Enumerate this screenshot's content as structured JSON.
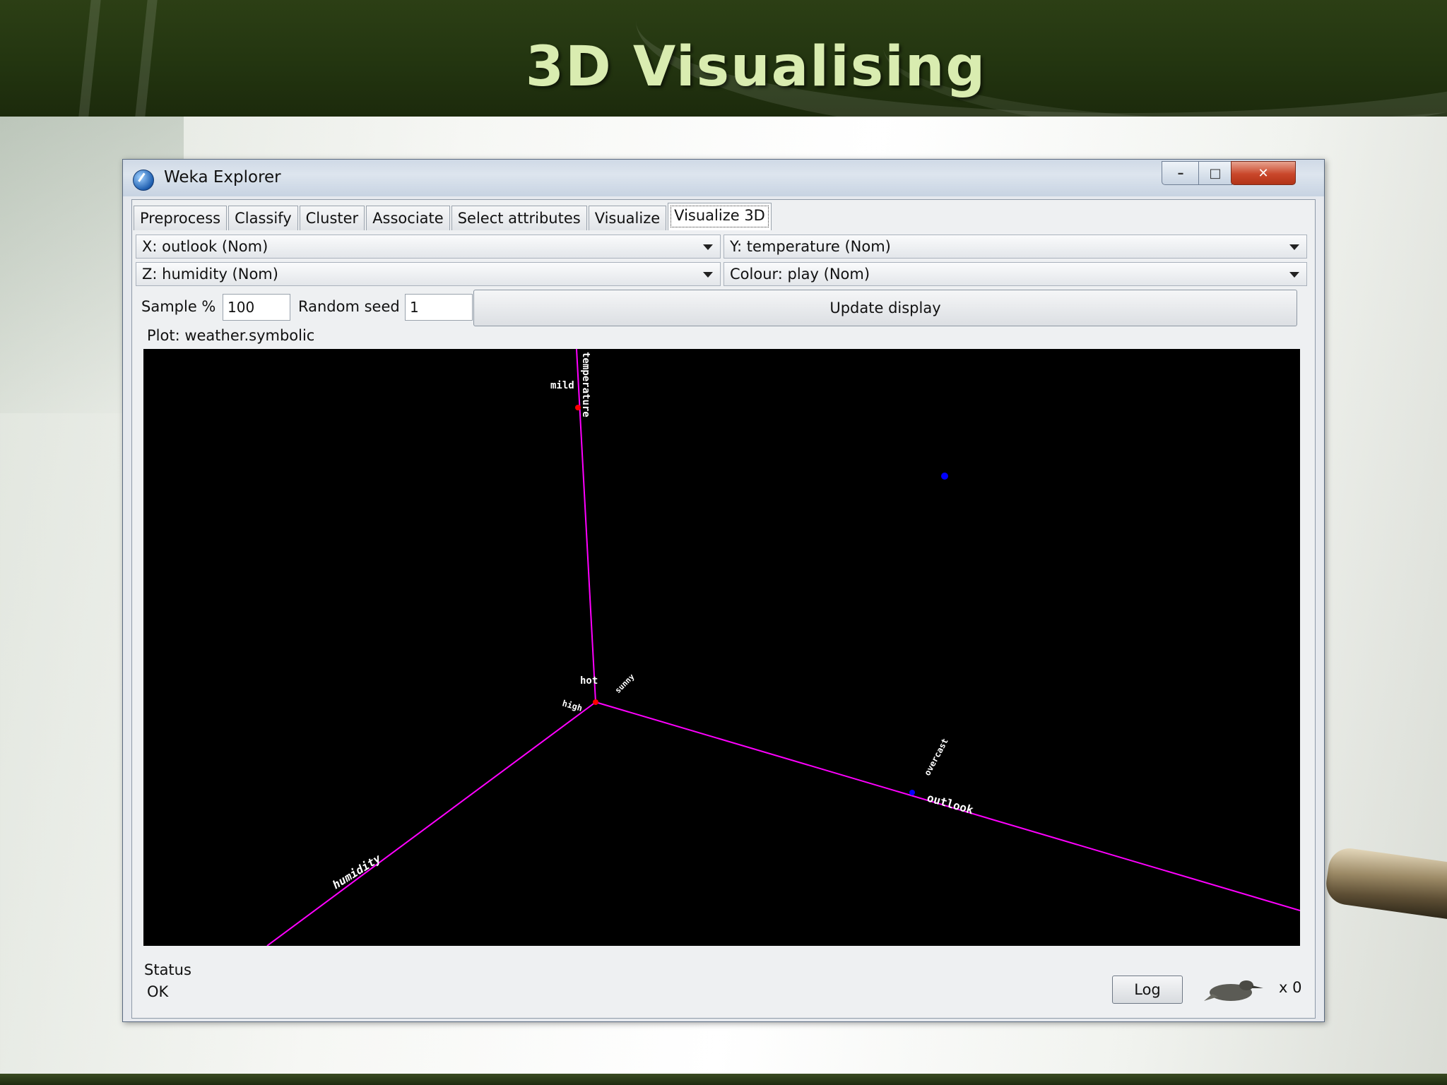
{
  "slide": {
    "title": "3D Visualising"
  },
  "window": {
    "title": "Weka Explorer",
    "controls": {
      "minimize": "–",
      "maximize": "□",
      "close": "✕"
    }
  },
  "tabs": [
    {
      "label": "Preprocess",
      "active": false
    },
    {
      "label": "Classify",
      "active": false
    },
    {
      "label": "Cluster",
      "active": false
    },
    {
      "label": "Associate",
      "active": false
    },
    {
      "label": "Select attributes",
      "active": false
    },
    {
      "label": "Visualize",
      "active": false
    },
    {
      "label": "Visualize 3D",
      "active": true
    }
  ],
  "selectors": {
    "x": "X: outlook (Nom)",
    "y": "Y: temperature (Nom)",
    "z": "Z: humidity (Nom)",
    "colour": "Colour: play (Nom)"
  },
  "sampling": {
    "sample_label": "Sample %",
    "sample_value": "100",
    "seed_label": "Random seed",
    "seed_value": "1",
    "update_label": "Update display"
  },
  "plot": {
    "label": "Plot: weather.symbolic",
    "axis_color": "#ff00ff",
    "background": "#000000",
    "axes": {
      "x": {
        "name": "outlook",
        "ticks": [
          "overcast"
        ]
      },
      "y": {
        "name": "temperature",
        "ticks": [
          "mild",
          "hot"
        ]
      },
      "z": {
        "name": "humidity",
        "ticks": [
          "high"
        ]
      },
      "extra_labels": [
        "sunny"
      ]
    },
    "point_colors": {
      "red": "#ff0000",
      "blue": "#0000ff"
    }
  },
  "status": {
    "label": "Status",
    "text": "OK",
    "log_label": "Log",
    "task_count": "x 0"
  }
}
